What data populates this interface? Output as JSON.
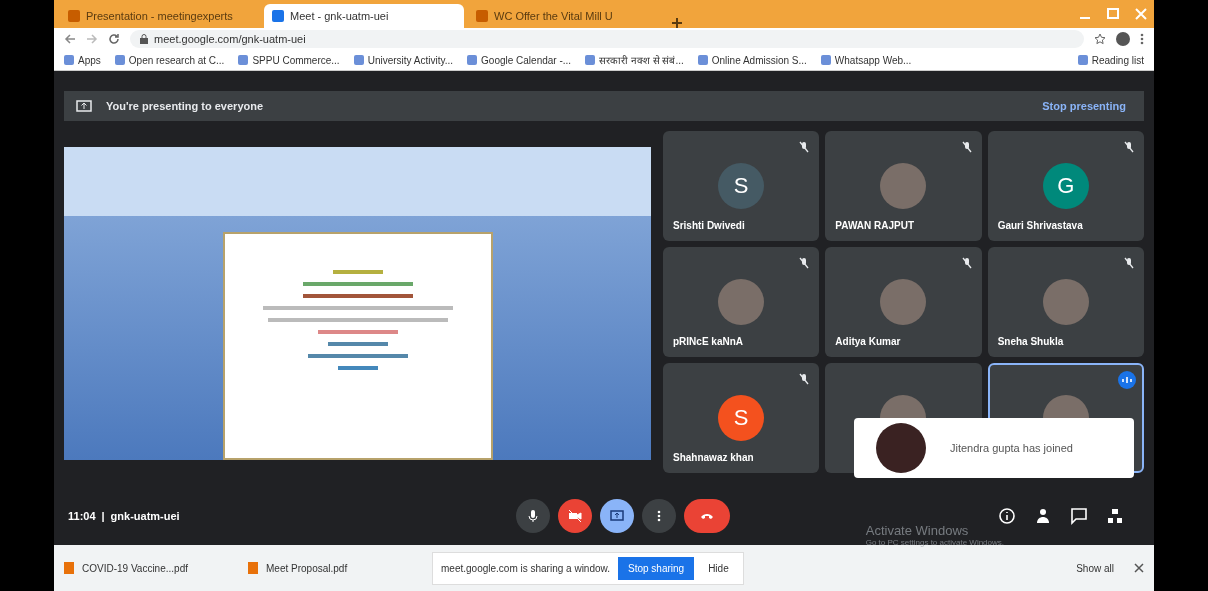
{
  "browser": {
    "tabs": [
      {
        "title": "Presentation - meetingexperts",
        "selected": false
      },
      {
        "title": "Meet - gnk-uatm-uei",
        "selected": true
      },
      {
        "title": "WC Offer the Vital Mill U",
        "selected": false
      }
    ],
    "address": "meet.google.com/gnk-uatm-uei",
    "bookmarks": [
      {
        "label": "Apps"
      },
      {
        "label": "Open research at C..."
      },
      {
        "label": "SPPU Commerce..."
      },
      {
        "label": "University Activity..."
      },
      {
        "label": "Google Calendar -..."
      },
      {
        "label": "सरकारी नक्श से संबं..."
      },
      {
        "label": "Online Admission S..."
      },
      {
        "label": "Whatsapp Web..."
      }
    ],
    "reading_list": "Reading list"
  },
  "meet": {
    "banner": {
      "text": "You're presenting to everyone",
      "action": "Stop presenting"
    },
    "participants": [
      {
        "name": "Srishti Dwivedi",
        "kind": "letter",
        "initial": "S",
        "color": "#455a64",
        "muted": true,
        "speaking": false
      },
      {
        "name": "PAWAN RAJPUT",
        "kind": "photo",
        "muted": true,
        "speaking": false
      },
      {
        "name": "Gauri Shrivastava",
        "kind": "letter",
        "initial": "G",
        "color": "#00897b",
        "muted": true,
        "speaking": false
      },
      {
        "name": "pRINcE kaNnA",
        "kind": "photo",
        "muted": true,
        "speaking": false
      },
      {
        "name": "Aditya Kumar",
        "kind": "photo",
        "muted": true,
        "speaking": false
      },
      {
        "name": "Sneha Shukla",
        "kind": "photo",
        "muted": true,
        "speaking": false
      },
      {
        "name": "Shahnawaz khan",
        "kind": "letter",
        "initial": "S",
        "color": "#f4511e",
        "muted": true,
        "speaking": false
      },
      {
        "kind": "photo",
        "muted": false,
        "speaking": false
      },
      {
        "kind": "photo",
        "muted": false,
        "speaking": true
      }
    ],
    "toast": "Jitendra gupta has joined",
    "meeting_time": "11:04",
    "separator": "|",
    "meeting_code": "gnk-uatm-uei",
    "controls": [
      {
        "kind": "mic",
        "off": false
      },
      {
        "kind": "camera",
        "off": true
      },
      {
        "kind": "present",
        "active": true
      },
      {
        "kind": "more"
      },
      {
        "kind": "hangup"
      }
    ]
  },
  "downloads": {
    "items": [
      {
        "name": "COVID-19 Vaccine...pdf"
      },
      {
        "name": "Meet Proposal.pdf"
      }
    ],
    "sharing": {
      "text": "meet.google.com is sharing a window.",
      "stop": "Stop sharing",
      "hide": "Hide"
    },
    "show_all": "Show all"
  },
  "os_notice": {
    "title": "Activate Windows",
    "subtitle": "Go to PC settings to activate Windows."
  }
}
